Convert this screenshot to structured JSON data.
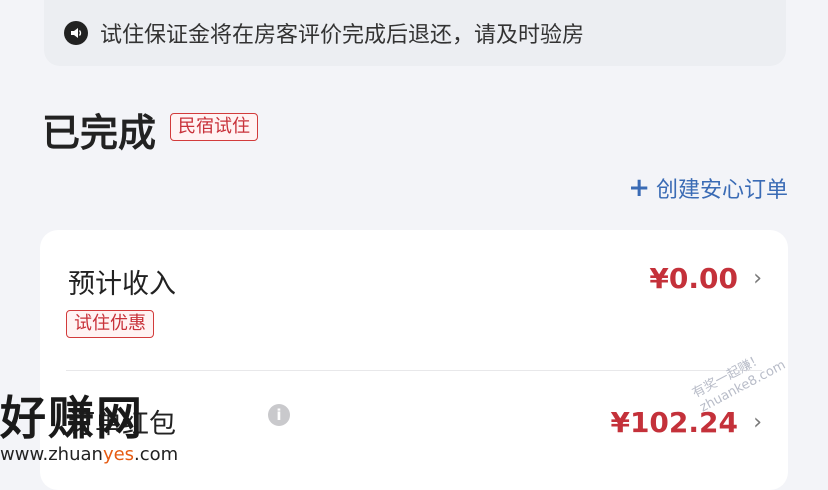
{
  "notice": {
    "icon": "speaker-icon",
    "text": "试住保证金将在房客评价完成后退还，请及时验房"
  },
  "order": {
    "status": "已完成",
    "type_tag": "民宿试住"
  },
  "actions": {
    "create_order_label": "创建安心订单",
    "create_order_icon": "plus-icon"
  },
  "income": {
    "title": "预计收入",
    "amount": "¥0.00",
    "tag": "试住优惠",
    "row2_title": "订单红包",
    "row2_amount": "¥102.24"
  },
  "watermark": {
    "main": "好赚网",
    "sub_prefix": "www.zhuan",
    "sub_highlight": "yes",
    "sub_suffix": ".com",
    "diag_1": "有奖一起赚！",
    "diag_2": "zhuanke8.com"
  },
  "colors": {
    "accent_red": "#c4313a",
    "link_blue": "#3a6bb5",
    "background": "#f3f4f8"
  }
}
